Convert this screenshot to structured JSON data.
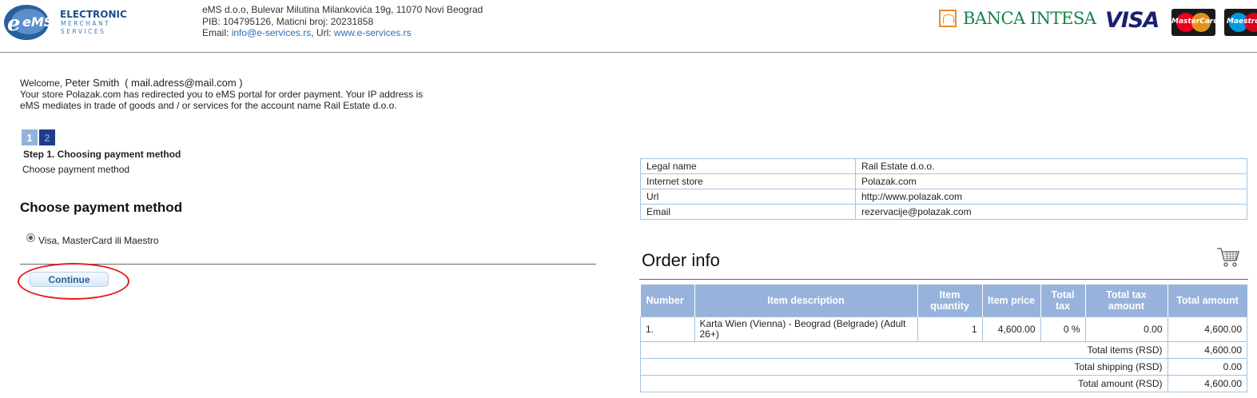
{
  "header": {
    "logo_brand": "eMS",
    "logo_line1": "ELECTRONIC",
    "logo_line2": "MERCHANT",
    "logo_line3": "SERVICES",
    "company_line1": "eMS d.o.o, Bulevar Milutina Milankovića 19g, 11070 Novi Beograd",
    "company_line2": "PIB: 104795126, Maticni broj: 20231858",
    "email_label": "Email: ",
    "email_value": "info@e-services.rs",
    "url_label": ", Url: ",
    "url_value": "www.e-services.rs",
    "bank_name": "BANCA INTESA",
    "visa_label": "VISA",
    "mastercard_label": "MasterCard",
    "maestro_label": "Maestro",
    "colors": {
      "intesa_green": "#16834a",
      "visa_blue": "#1a1f71",
      "mc_red": "#eb001b",
      "mc_yellow": "#f79e1b",
      "maestro_blue": "#0099df"
    }
  },
  "welcome": {
    "prefix": "Welcome, ",
    "user_name": "Peter Smith",
    "user_email": "( mail.adress@mail.com )",
    "line2": "Your store Polazak.com has redirected you to eMS portal for order payment. Your IP address is",
    "line3": "eMS mediates in trade of goods and / or services for the account name Rail Estate d.o.o."
  },
  "steps": {
    "items": [
      "1",
      "2"
    ],
    "active_index": 0,
    "title": "Step 1. Choosing payment method",
    "subtitle": "Choose payment method"
  },
  "payment": {
    "heading": "Choose payment method",
    "option_label": "Visa, MasterCard ili Maestro",
    "option_selected": true,
    "continue_label": "Continue"
  },
  "merchant": [
    {
      "key": "Legal name",
      "value": "Rail Estate d.o.o."
    },
    {
      "key": "Internet store",
      "value": "Polazak.com"
    },
    {
      "key": "Url",
      "value": "http://www.polazak.com"
    },
    {
      "key": "Email",
      "value": "rezervacije@polazak.com"
    }
  ],
  "order": {
    "title": "Order info",
    "cart_icon": "shopping-cart-icon",
    "headers": [
      "Number",
      "Item description",
      "Item quantity",
      "Item price",
      "Total tax",
      "Total tax amount",
      "Total amount"
    ],
    "rows": [
      {
        "number": "1.",
        "description": "Karta Wien (Vienna) - Beograd (Belgrade) (Adult 26+)",
        "quantity": "1",
        "price": "4,600.00",
        "tax": "0 %",
        "tax_amount": "0.00",
        "amount": "4,600.00"
      }
    ],
    "totals": [
      {
        "label": "Total items (RSD)",
        "value": "4,600.00"
      },
      {
        "label": "Total shipping (RSD)",
        "value": "0.00"
      },
      {
        "label": "Total amount (RSD)",
        "value": "4,600.00"
      }
    ]
  }
}
